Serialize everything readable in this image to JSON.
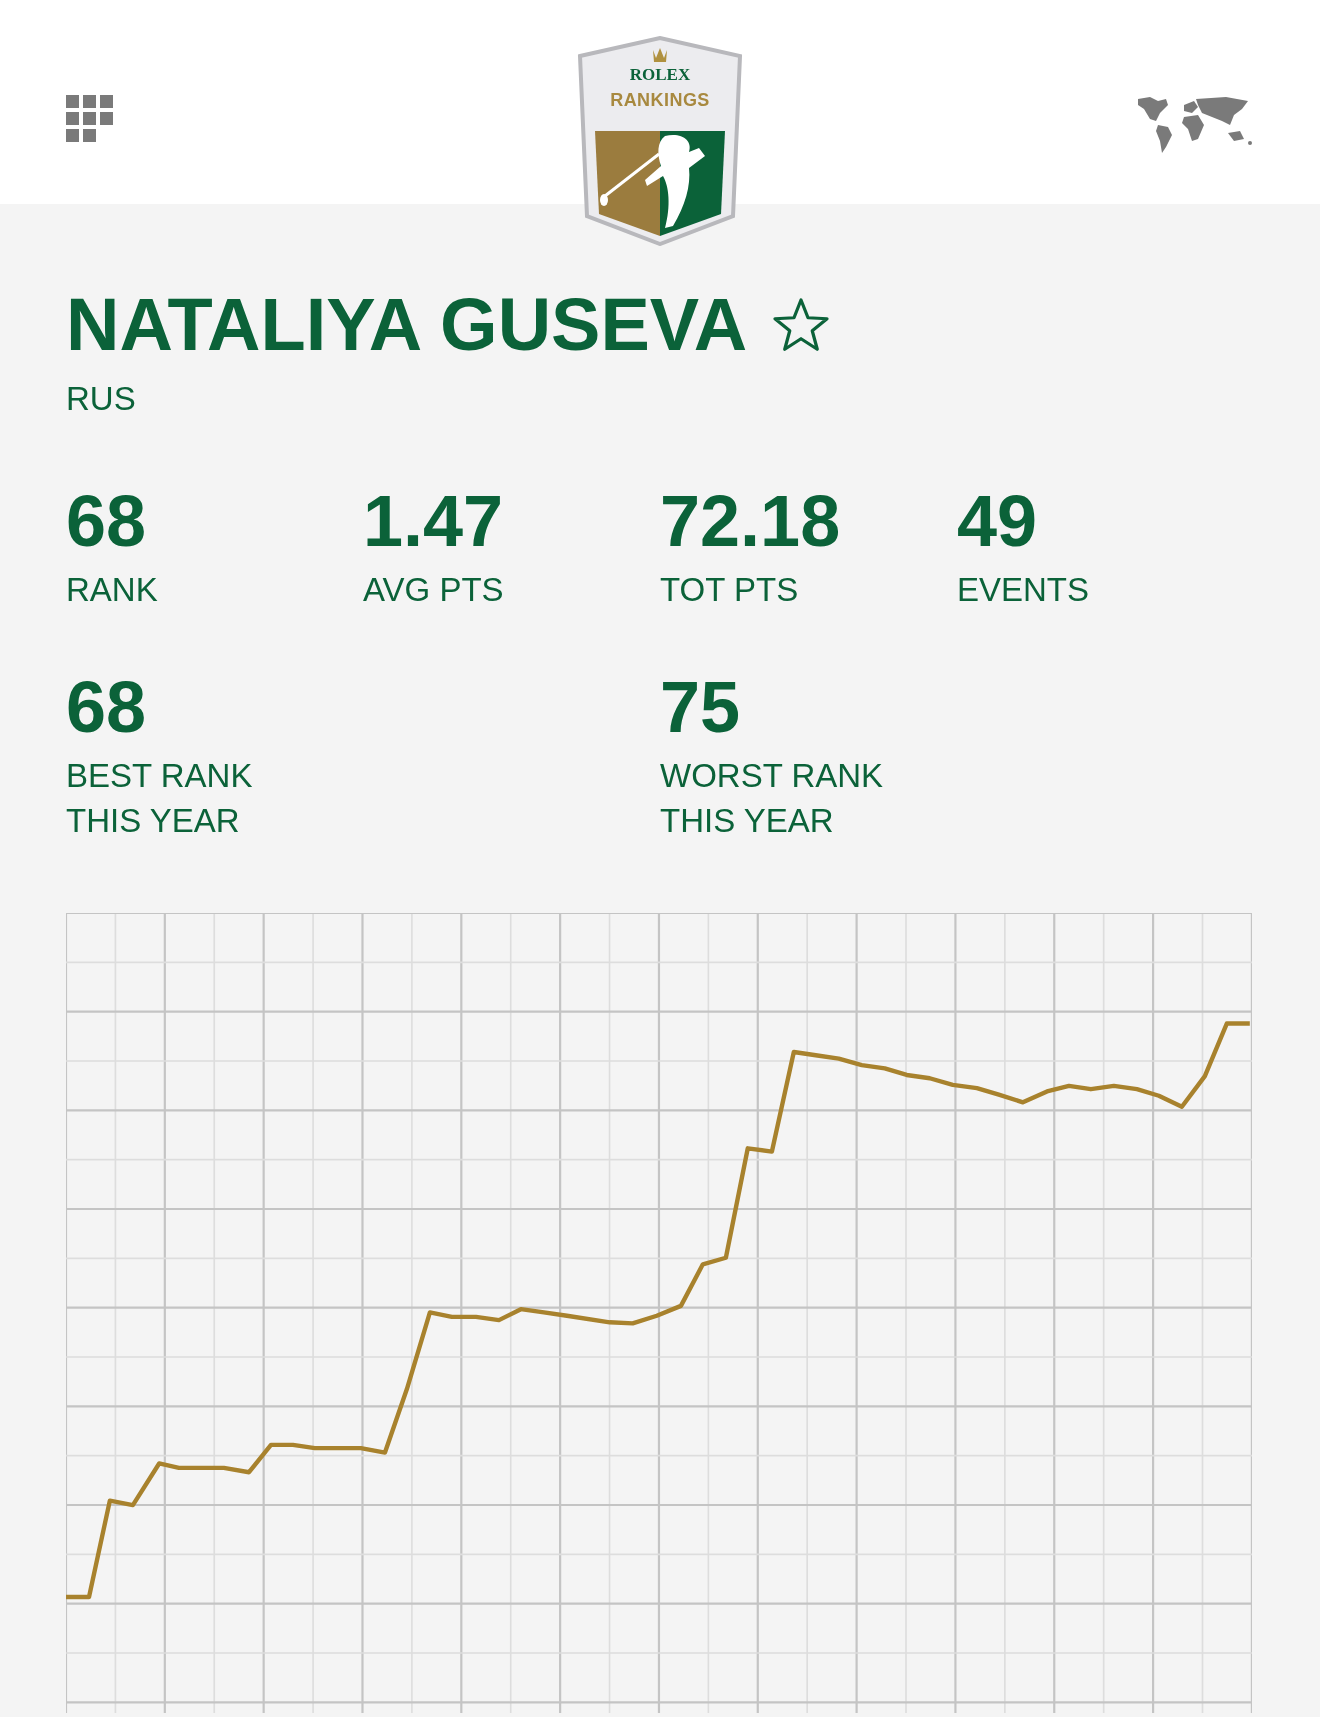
{
  "header": {
    "logo": {
      "brand": "ROLEX",
      "title": "RANKINGS"
    }
  },
  "player": {
    "name": "NATALIYA GUSEVA",
    "favorite": false,
    "country": "RUS"
  },
  "stats": [
    {
      "value": "68",
      "label": "RANK"
    },
    {
      "value": "1.47",
      "label": "AVG PTS"
    },
    {
      "value": "72.18",
      "label": "TOT PTS"
    },
    {
      "value": "49",
      "label": "EVENTS"
    }
  ],
  "year_stats": [
    {
      "value": "68",
      "label": "BEST RANK",
      "sublabel": "THIS YEAR"
    },
    {
      "value": "75",
      "label": "WORST RANK",
      "sublabel": "THIS YEAR"
    }
  ]
}
